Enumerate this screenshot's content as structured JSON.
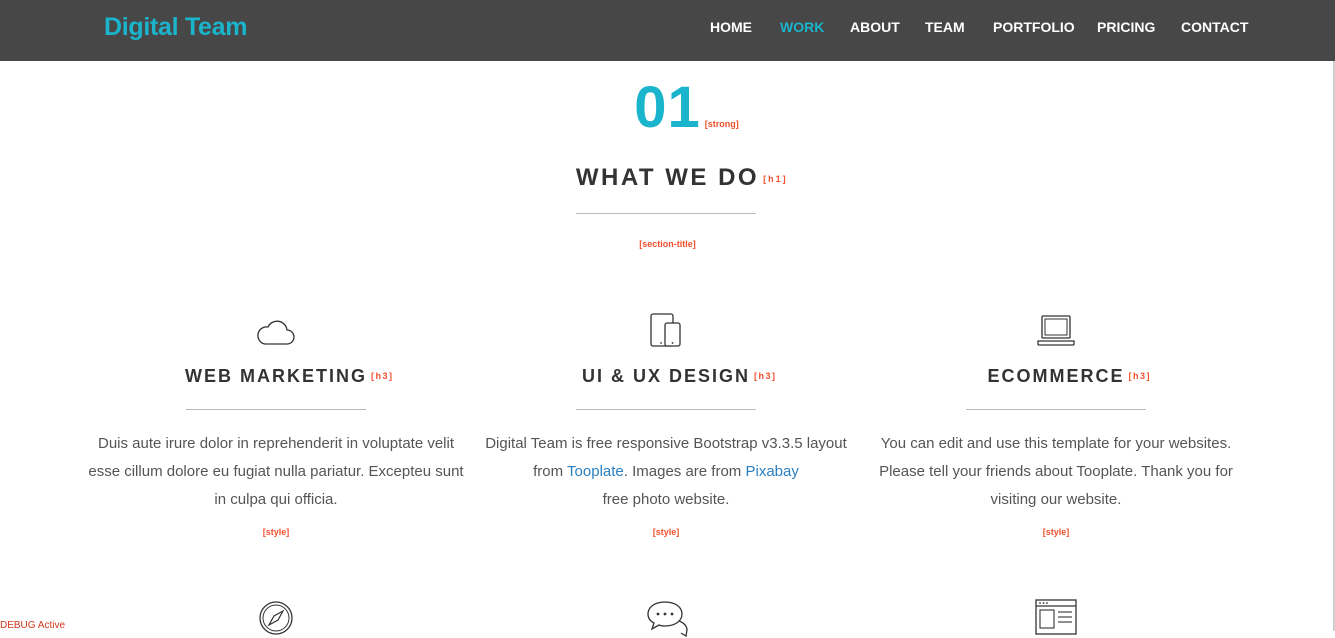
{
  "nav": {
    "brand": "Digital Team",
    "items": [
      "HOME",
      "WORK",
      "ABOUT",
      "TEAM",
      "PORTFOLIO",
      "PRICING",
      "CONTACT"
    ],
    "active": "WORK"
  },
  "section": {
    "number": "01",
    "number_tag": "[strong]",
    "title": "WHAT WE DO",
    "title_tag": "[h1]",
    "section_tag": "[section-title]"
  },
  "services": [
    {
      "icon": "cloud-icon",
      "title": "WEB MARKETING",
      "title_tag": "[h3]",
      "text": "Duis aute irure dolor in reprehenderit in voluptate velit esse cillum dolore eu fugiat nulla pariatur. Excepteu sunt in culpa qui officia.",
      "style_tag": "[style]"
    },
    {
      "icon": "devices-icon",
      "title": "UI & UX DESIGN",
      "title_tag": "[h3]",
      "text_before": "Digital Team is free responsive Bootstrap v3.3.5 layout from ",
      "link1": "Tooplate",
      "text_middle": ". Images are from ",
      "link2": "Pixabay",
      "text_after": " free photo website.",
      "style_tag": "[style]"
    },
    {
      "icon": "laptop-icon",
      "title": "ECOMMERCE",
      "title_tag": "[h3]",
      "text": "You can edit and use this template for your websites. Please tell your friends about Tooplate. Thank you for visiting our website.",
      "style_tag": "[style]"
    }
  ],
  "next_row_icons": [
    "compass-icon",
    "chat-icon",
    "browser-icon"
  ],
  "debug_label": "DEBUG Active",
  "colors": {
    "navbar": "#474747",
    "accent": "#1ab4cc",
    "debug_tag": "#f0502d",
    "link": "#2a80c4"
  }
}
